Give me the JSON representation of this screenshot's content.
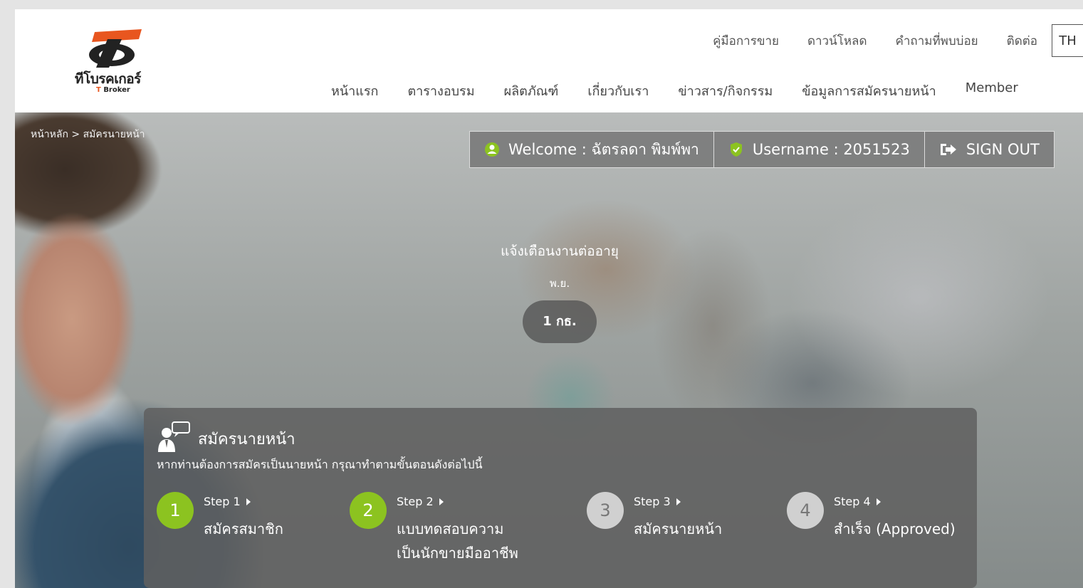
{
  "header": {
    "logo_text": "ทีโบรคเกอร์",
    "logo_sub_prefix": "T",
    "logo_sub": "Broker",
    "top_links": [
      "คู่มือการขาย",
      "ดาวน์โหลด",
      "คำถามที่พบบ่อย",
      "ติดต่อ"
    ],
    "lang": "TH",
    "nav": [
      "หน้าแรก",
      "ตารางอบรม",
      "ผลิตภัณฑ์",
      "เกี่ยวกับเรา",
      "ข่าวสาร/กิจกรรม",
      "ข้อมูลการสมัครนายหน้า",
      "Member"
    ],
    "logo_colors": {
      "orange": "#e8561f",
      "dark": "#222222"
    }
  },
  "breadcrumb": "หน้าหลัก > สมัครนายหน้า",
  "userbar": {
    "welcome": "Welcome : ฉัตรลดา พิมพ์พา",
    "username": "Username : 2051523",
    "signout": "SIGN OUT",
    "icons": [
      "user-icon",
      "check-shield-icon",
      "sign-out-icon"
    ]
  },
  "notice": {
    "title": "แจ้งเตือนงานต่ออายุ",
    "month": "พ.ย.",
    "date": "1 กธ."
  },
  "register": {
    "title": "สมัครนายหน้า",
    "desc": "หากท่านต้องการสมัครเป็นนายหน้า กรุณาทำตามขั้นตอนดังต่อไปนี้",
    "steps": [
      {
        "num": "1",
        "label": "Step 1",
        "title": "สมัครสมาชิก",
        "title2": "",
        "status": "active"
      },
      {
        "num": "2",
        "label": "Step 2",
        "title": "แบบทดสอบความ",
        "title2": "เป็นนักขายมืออาชีพ",
        "status": "active"
      },
      {
        "num": "3",
        "label": "Step 3",
        "title": "สมัครนายหน้า",
        "title2": "",
        "status": "inactive"
      },
      {
        "num": "4",
        "label": "Step 4",
        "title": "สำเร็จ (Approved)",
        "title2": "",
        "status": "inactive"
      }
    ],
    "colors": {
      "active": "#8cc320",
      "inactive": "#d0d0d0"
    }
  }
}
